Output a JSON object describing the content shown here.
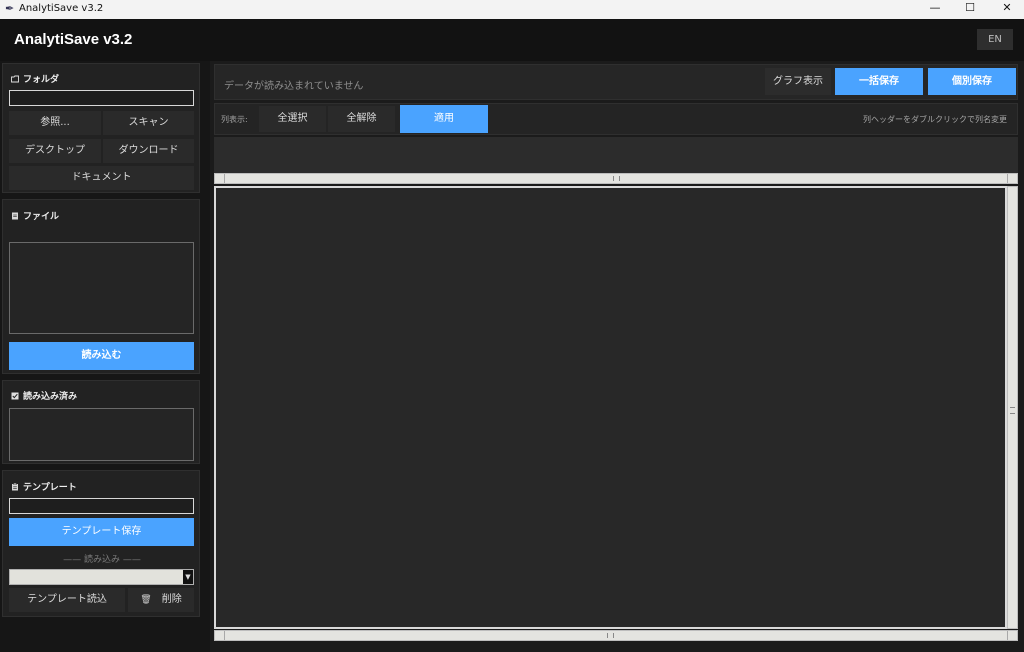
{
  "window": {
    "title": "AnalytiSave v3.2",
    "app_icon": "feather-icon",
    "minimize_glyph": "—",
    "maximize_glyph": "☐",
    "close_glyph": "✕"
  },
  "header": {
    "app_title": "AnalytiSave v3.2",
    "lang_button": "EN"
  },
  "sidebar": {
    "folder": {
      "heading": "フォルダ",
      "path_value": "",
      "buttons": {
        "browse": "参照...",
        "scan": "スキャン",
        "desktop": "デスクトップ",
        "download": "ダウンロード",
        "documents": "ドキュメント"
      }
    },
    "files": {
      "heading": "ファイル",
      "load_button": "読み込む"
    },
    "loaded": {
      "heading": "読み込み済み"
    },
    "template": {
      "heading": "テンプレート",
      "name_value": "",
      "save_button": "テンプレート保存",
      "load_divider": "—— 読み込み ——",
      "selected_value": "",
      "load_button": "テンプレート読込",
      "delete_button": "削除"
    }
  },
  "main": {
    "status_text": "データが読み込まれていません",
    "graph_button": "グラフ表示",
    "bulk_save_button": "一括保存",
    "individual_save_button": "個別保存",
    "column_label": "列表示:",
    "select_all_button": "全選択",
    "deselect_all_button": "全解除",
    "apply_button": "適用",
    "hint_text": "列ヘッダーをダブルクリックで列名変更"
  },
  "colors": {
    "accent": "#4aa3ff",
    "background": "#1b1b1b",
    "panel": "#222222"
  }
}
